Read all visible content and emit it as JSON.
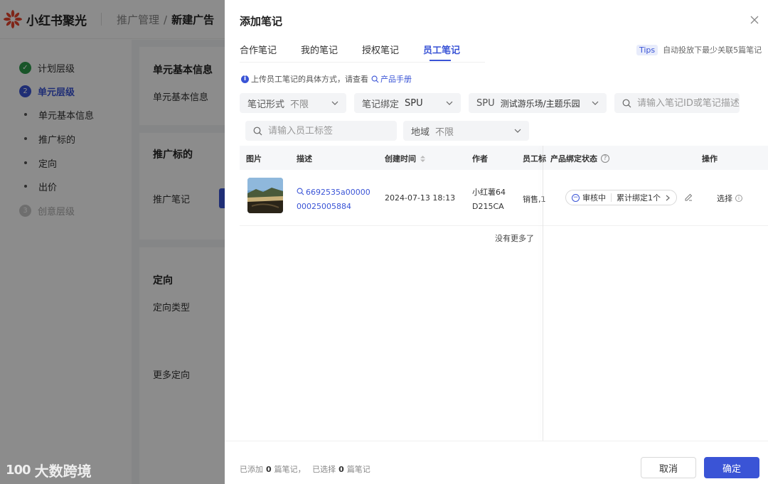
{
  "app": {
    "brand": "小红书聚光",
    "breadcrumb": {
      "parent": "推广管理",
      "separator": "/",
      "current": "新建广告"
    }
  },
  "leftnav": {
    "items": [
      {
        "label": "计划层级",
        "step": "✓"
      },
      {
        "label": "单元层级",
        "step": "2"
      },
      {
        "label": "单元基本信息"
      },
      {
        "label": "推广标的"
      },
      {
        "label": "定向"
      },
      {
        "label": "出价"
      },
      {
        "label": "创意层级",
        "step": "3"
      }
    ]
  },
  "background_cards": {
    "unit_basic": {
      "title": "单元基本信息",
      "field": "单元基本信息"
    },
    "target": {
      "title": "推广标的",
      "field": "推广笔记"
    },
    "targeting": {
      "title": "定向",
      "field": "定向类型",
      "more": "更多定向"
    }
  },
  "watermark": {
    "logo": "100",
    "text": "大数跨境"
  },
  "drawer": {
    "title": "添加笔记",
    "tabs": [
      "合作笔记",
      "我的笔记",
      "授权笔记",
      "员工笔记"
    ],
    "active_tab": 3,
    "tips": {
      "badge": "Tips",
      "text": "自动投放下最少关联5篇笔记"
    },
    "info": {
      "text": "上传员工笔记的具体方式，请查看",
      "link": "产品手册"
    },
    "filters": {
      "note_form": {
        "label": "笔记形式",
        "value": "不限"
      },
      "note_binding": {
        "label": "笔记绑定",
        "value": "SPU"
      },
      "spu": {
        "label": "SPU",
        "value": "测试游乐场/主题乐园"
      },
      "search": {
        "placeholder": "请输入笔记ID或笔记描述"
      },
      "staff_tag": {
        "placeholder": "请输入员工标签"
      },
      "region": {
        "label": "地域",
        "value": "不限"
      }
    },
    "table": {
      "headers": {
        "image": "图片",
        "desc": "描述",
        "created": "创建时间",
        "author": "作者",
        "staff_tag": "员工标",
        "binding_status": "产品绑定状态",
        "action": "操作"
      },
      "rows": [
        {
          "desc_line1": "6692535a00000",
          "desc_line2": "00025005884",
          "created": "2024-07-13 18:13",
          "author_line1": "小红薯64",
          "author_line2": "D215CA",
          "staff_tag": "销售,1",
          "status": "审核中",
          "bind_count": "累计绑定1个",
          "action": "选择"
        }
      ],
      "empty_more": "没有更多了"
    },
    "footer": {
      "added_prefix": "已添加",
      "added_count": "0",
      "added_suffix": "篇笔记，",
      "selected_prefix": "已选择",
      "selected_count": "0",
      "selected_suffix": "篇笔记",
      "cancel": "取消",
      "confirm": "确定"
    }
  }
}
